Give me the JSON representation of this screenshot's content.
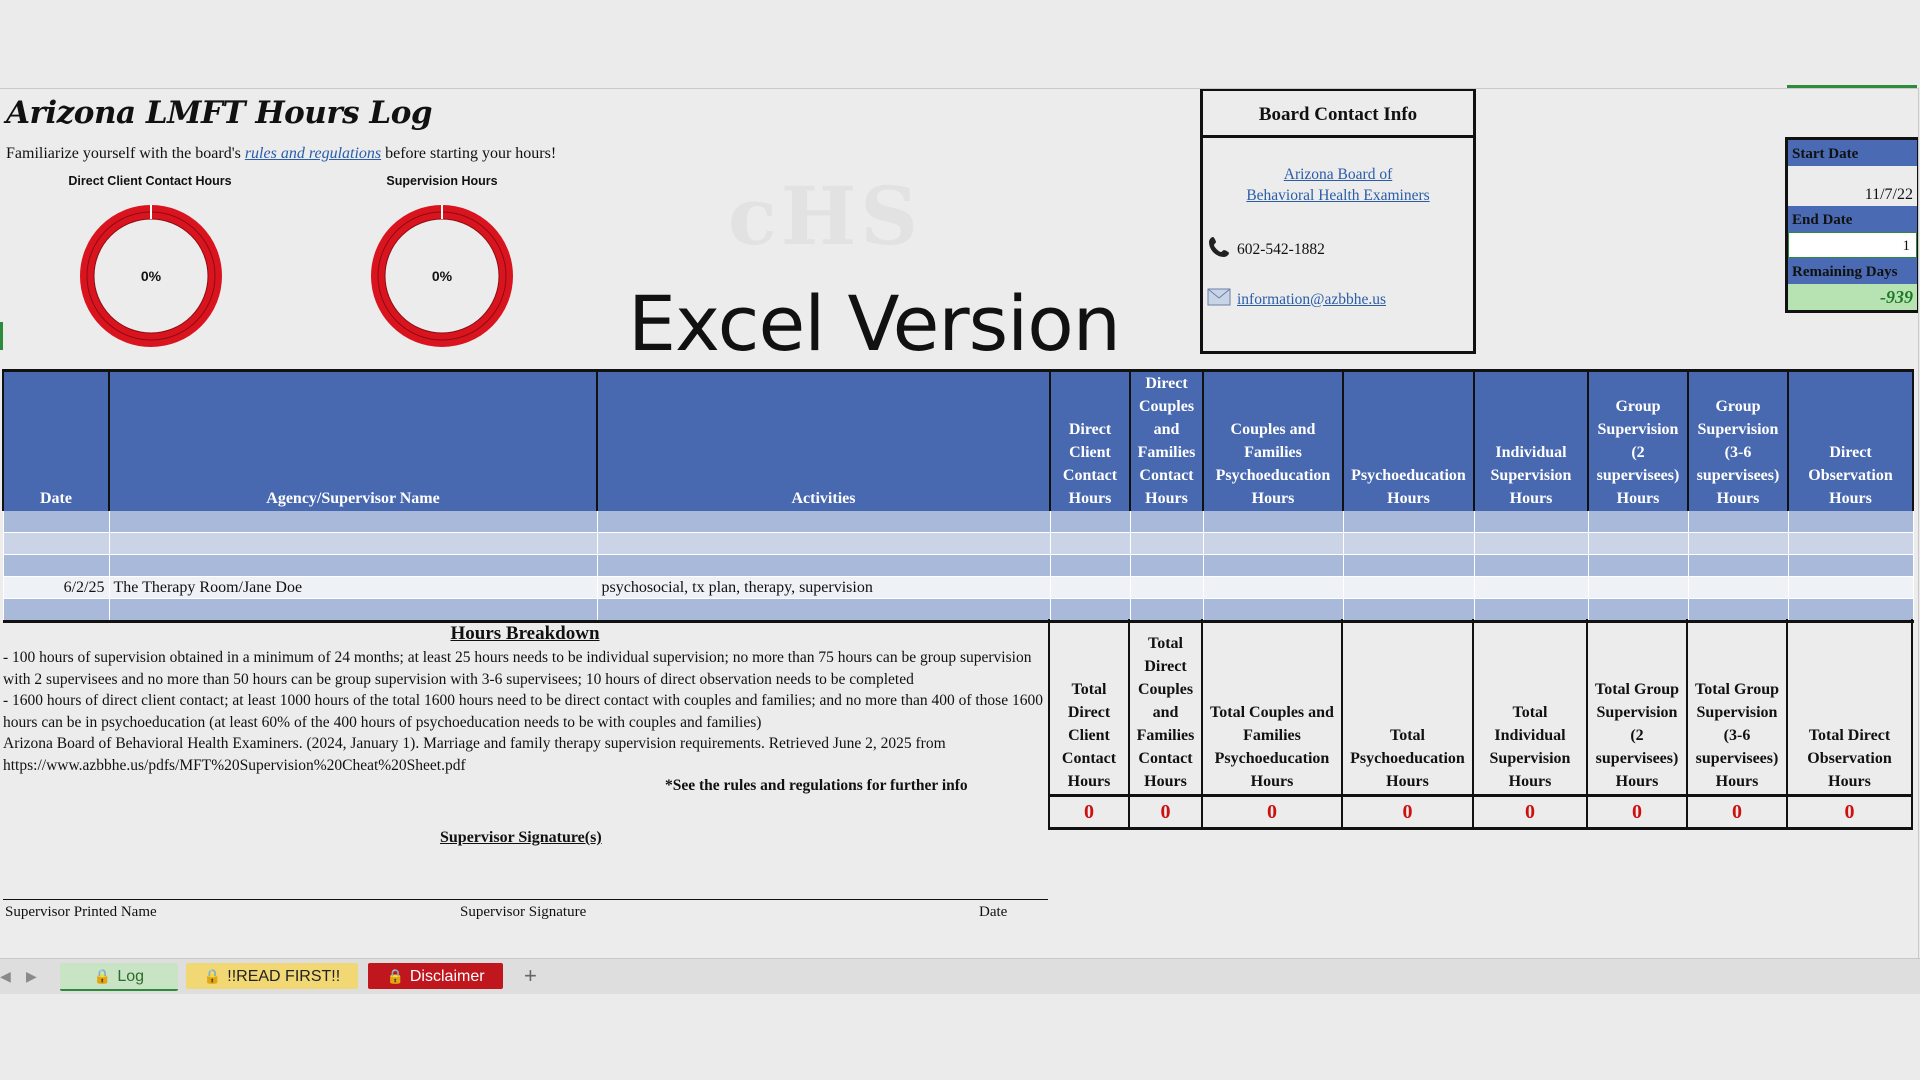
{
  "header": {
    "title": "Arizona LMFT Hours Log",
    "subtitle_pre": "Familiarize yourself with the board's ",
    "subtitle_link": "rules and regulations",
    "subtitle_post": " before starting your hours!",
    "watermark": "cHS",
    "excel_version": "Excel Version"
  },
  "donuts": [
    {
      "label": "Direct Client Contact Hours",
      "percent_text": "0%",
      "value": 0,
      "color": "#d9141e"
    },
    {
      "label": "Supervision Hours",
      "percent_text": "0%",
      "value": 0,
      "color": "#d9141e"
    }
  ],
  "board": {
    "title": "Board Contact Info",
    "link_line1": "Arizona Board of",
    "link_line2": "Behavioral Health Examiners",
    "phone_icon": "phone-icon",
    "phone": "602-542-1882",
    "email_icon": "email-icon",
    "email": "information@azbbhe.us"
  },
  "dates": {
    "start_label": "Start Date",
    "start_value": "11/7/22",
    "end_label": "End Date",
    "end_value": "1",
    "remaining_label": "Remaining Days",
    "remaining_value": "-939"
  },
  "log_table": {
    "columns": [
      "Date",
      "Agency/Supervisor Name",
      "Activities",
      "Direct Client Contact Hours",
      "Direct Couples and Families Contact Hours",
      "Couples and Families Psychoeducation Hours",
      "Psychoeducation Hours",
      "Individual Supervision Hours",
      "Group Supervision (2 supervisees) Hours",
      "Group Supervision (3-6 supervisees) Hours",
      "Direct Observation Hours"
    ],
    "rows": [
      [
        "",
        "",
        "",
        "",
        "",
        "",
        "",
        "",
        "",
        "",
        ""
      ],
      [
        "",
        "",
        "",
        "",
        "",
        "",
        "",
        "",
        "",
        "",
        ""
      ],
      [
        "",
        "",
        "",
        "",
        "",
        "",
        "",
        "",
        "",
        "",
        ""
      ],
      [
        "6/2/25",
        "The Therapy Room/Jane Doe",
        "psychosocial, tx plan, therapy, supervision",
        "",
        "",
        "",
        "",
        "",
        "",
        "",
        ""
      ],
      [
        "",
        "",
        "",
        "",
        "",
        "",
        "",
        "",
        "",
        "",
        ""
      ]
    ]
  },
  "breakdown": {
    "title": "Hours Breakdown",
    "line1": "- 100 hours of supervision obtained in a minimum of 24 months; at least 25 hours needs to be individual supervision; no more than 75 hours can be group supervision with 2 supervisees and no more than 50 hours can be group supervision with 3-6 supervisees; 10 hours of direct observation needs to be completed",
    "line2": "- 1600 hours of direct client contact; at least 1000 hours of the total 1600 hours need to be direct contact with couples and families; and no more than 400 of those 1600 hours can be in psychoeducation (at least 60% of the 400 hours of psychoeducation needs to be with couples and families)",
    "line3": "Arizona Board of Behavioral Health Examiners. (2024, January 1). Marriage and family therapy supervision requirements. Retrieved June 2, 2025 from",
    "line4": "https://www.azbbhe.us/pdfs/MFT%20Supervision%20Cheat%20Sheet.pdf",
    "note": "*See the rules and regulations for further info"
  },
  "totals": {
    "headers": [
      "Total Direct Client Contact Hours",
      "Total Direct Couples and Families Contact Hours",
      "Total Couples and Families Psychoeducation Hours",
      "Total Psychoeducation Hours",
      "Total Individual Supervision Hours",
      "Total Group Supervision (2 supervisees) Hours",
      "Total Group Supervision (3-6 supervisees) Hours",
      "Total Direct Observation Hours"
    ],
    "values": [
      "0",
      "0",
      "0",
      "0",
      "0",
      "0",
      "0",
      "0"
    ]
  },
  "signature": {
    "title": "Supervisor Signature(s)",
    "printed_name": "Supervisor Printed Name",
    "signature": "Supervisor Signature",
    "date": "Date"
  },
  "tabs": {
    "log": "Log",
    "read_first": "!!READ FIRST!!",
    "disclaimer": "Disclaimer",
    "add": "+",
    "lock_icon": "lock-icon"
  }
}
